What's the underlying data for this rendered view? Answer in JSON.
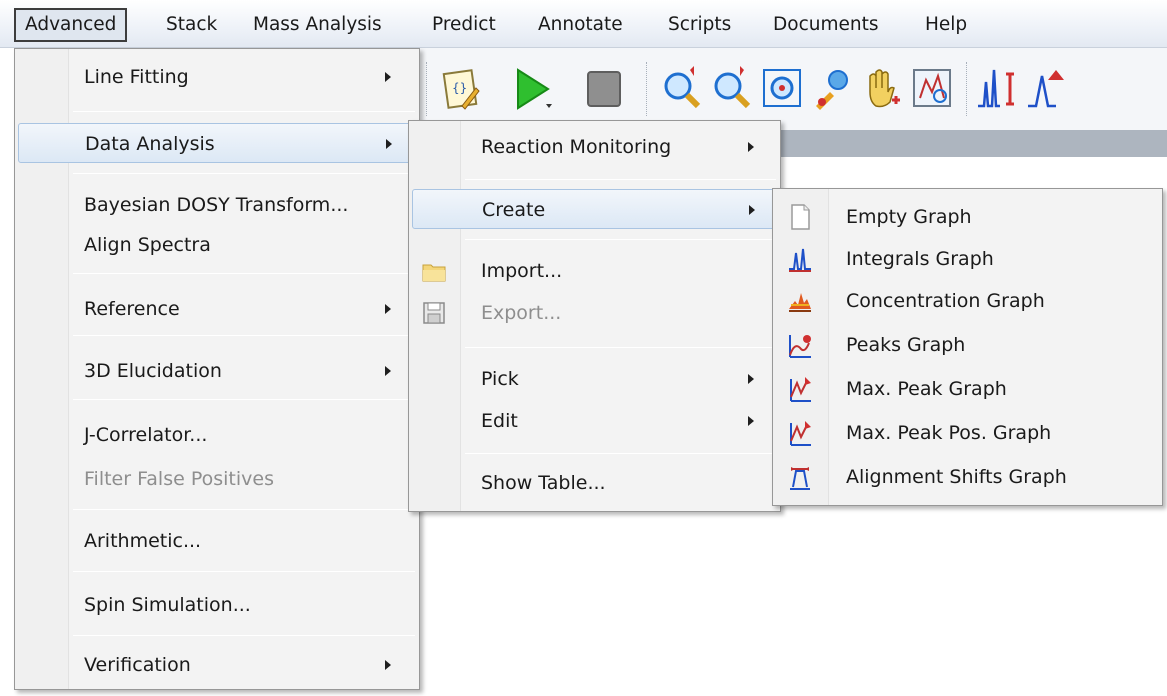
{
  "menubar": {
    "items": [
      "Advanced",
      "Stack",
      "Mass Analysis",
      "Predict",
      "Annotate",
      "Scripts",
      "Documents",
      "Help"
    ]
  },
  "toolbar": {
    "icons": [
      "script-icon",
      "run-icon",
      "stop-icon",
      "zoom-in-icon",
      "zoom-out-icon",
      "zoom-fit-icon",
      "pick-icon",
      "pan-icon",
      "crosshair-icon",
      "chart-icon",
      "integrals-icon",
      "peak-icon"
    ]
  },
  "menu_advanced": {
    "items": [
      {
        "label": "Line Fitting",
        "submenu": true
      },
      {
        "label": "Data Analysis",
        "submenu": true
      },
      {
        "label": "Bayesian DOSY Transform..."
      },
      {
        "label": "Align Spectra"
      },
      {
        "label": "Reference",
        "submenu": true
      },
      {
        "label": "3D Elucidation",
        "submenu": true
      },
      {
        "label": "J-Correlator..."
      },
      {
        "label": "Filter False Positives",
        "disabled": true
      },
      {
        "label": "Arithmetic..."
      },
      {
        "label": "Spin Simulation..."
      },
      {
        "label": "Verification",
        "submenu": true
      }
    ]
  },
  "menu_data_analysis": {
    "items": [
      {
        "label": "Reaction Monitoring",
        "submenu": true
      },
      {
        "label": "Create",
        "submenu": true
      },
      {
        "label": "Import...",
        "icon": "folder-icon"
      },
      {
        "label": "Export...",
        "icon": "save-icon",
        "disabled": true
      },
      {
        "label": "Pick",
        "submenu": true
      },
      {
        "label": "Edit",
        "submenu": true
      },
      {
        "label": "Show Table..."
      }
    ]
  },
  "menu_create": {
    "items": [
      {
        "label": "Empty Graph",
        "icon": "empty-graph-icon"
      },
      {
        "label": "Integrals Graph",
        "icon": "integrals-graph-icon"
      },
      {
        "label": "Concentration Graph",
        "icon": "concentration-graph-icon"
      },
      {
        "label": "Peaks Graph",
        "icon": "peaks-graph-icon"
      },
      {
        "label": "Max. Peak Graph",
        "icon": "max-peak-graph-icon"
      },
      {
        "label": "Max. Peak Pos. Graph",
        "icon": "max-peak-pos-graph-icon"
      },
      {
        "label": "Alignment Shifts Graph",
        "icon": "alignment-shifts-graph-icon"
      }
    ]
  },
  "colors": {
    "highlight": "#dce8f5",
    "menu_bg": "#f3f3f3",
    "disabled_text": "#8e8e8e"
  }
}
